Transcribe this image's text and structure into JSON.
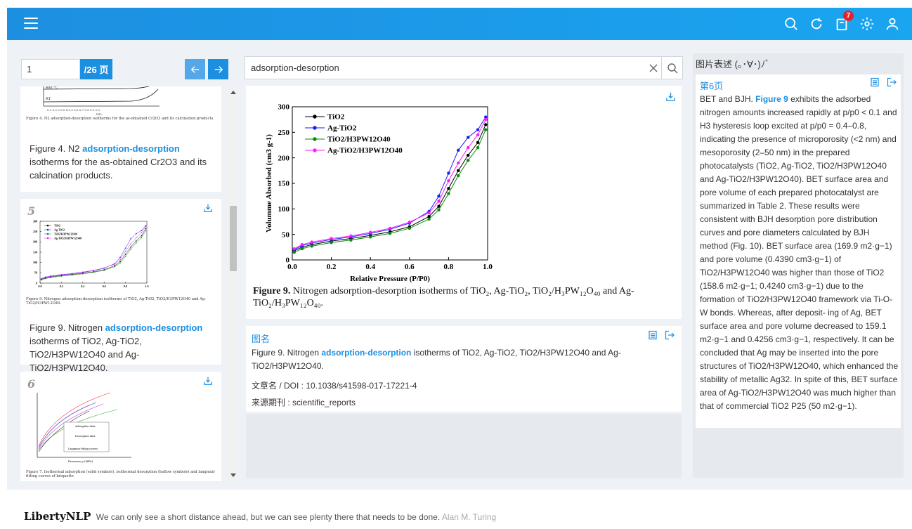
{
  "header": {
    "menu_icon": "hamburger-menu-icon",
    "icons": [
      "search-icon",
      "refresh-icon",
      "document-icon",
      "gear-icon",
      "user-icon"
    ],
    "badge_count": "7",
    "accent_color": "#1d8fe1"
  },
  "pager": {
    "page_value": "1",
    "total_label": "/26 页"
  },
  "cards": [
    {
      "caption_small": "Figure 4.  N2 adsorption-desorption isotherms for the as-obtained Cr2O3 and its calcination products.",
      "text_before": "Figure 4. N2 ",
      "highlight": "adsorption-desorption",
      "text_after": " isotherms for the as-obtained Cr2O3 and its calcination products."
    },
    {
      "num": "5",
      "caption_small": "Figure 9.  Nitrogen adsorption-desorption isotherms of TiO2, Ag-TiO2, TiO2/H3PW12O40 and Ag-TiO2/H3PW12O40.",
      "text_before": "Figure 9. Nitrogen ",
      "highlight": "adsorption-desorption",
      "text_after": " isotherms of TiO2, Ag-TiO2, TiO2/H3PW12O40 and Ag-TiO2/H3PW12O40."
    },
    {
      "num": "6",
      "caption_small": "Figure 7.  Isothermal adsorption (solid symbols), isothermal desorption (hollow symbols) and langmuir fitting curves of briquette"
    }
  ],
  "search": {
    "value": "adsorption-desorption"
  },
  "figure": {
    "caption_bold": "Figure 9.",
    "caption_text": "  Nitrogen adsorption-desorption isotherms of TiO₂, Ag-TiO₂, TiO₂/H₃PW₁₂O₄₀ and Ag-TiO₂/H₃PW₁₂O₄₀."
  },
  "chart_data": {
    "type": "line",
    "xlabel": "Relative Pressure (P/P0)",
    "ylabel": "Volumme Absorbed (cm3 g-1)",
    "xlim": [
      0,
      1.0
    ],
    "ylim": [
      0,
      300
    ],
    "xticks": [
      "0.0",
      "0.2",
      "0.4",
      "0.6",
      "0.8",
      "1.0"
    ],
    "yticks": [
      "0",
      "50",
      "100",
      "150",
      "200",
      "250",
      "300"
    ],
    "legend_position": "top-left",
    "series": [
      {
        "name": "TiO2",
        "color": "#000000",
        "x": [
          0.01,
          0.05,
          0.1,
          0.2,
          0.3,
          0.4,
          0.5,
          0.6,
          0.7,
          0.75,
          0.8,
          0.85,
          0.9,
          0.95,
          0.99
        ],
        "y": [
          18,
          25,
          30,
          37,
          42,
          48,
          55,
          65,
          85,
          105,
          140,
          175,
          205,
          230,
          265
        ]
      },
      {
        "name": "Ag-TiO2",
        "color": "#1a1aff",
        "x": [
          0.01,
          0.05,
          0.1,
          0.2,
          0.3,
          0.4,
          0.5,
          0.6,
          0.7,
          0.75,
          0.8,
          0.85,
          0.9,
          0.95,
          0.99
        ],
        "y": [
          20,
          28,
          33,
          40,
          45,
          52,
          60,
          72,
          95,
          125,
          170,
          215,
          240,
          255,
          280
        ]
      },
      {
        "name": "TiO2/H3PW12O40",
        "color": "#0a8a0a",
        "x": [
          0.01,
          0.05,
          0.1,
          0.2,
          0.3,
          0.4,
          0.5,
          0.6,
          0.7,
          0.75,
          0.8,
          0.85,
          0.9,
          0.95,
          0.99
        ],
        "y": [
          15,
          22,
          27,
          34,
          39,
          45,
          52,
          62,
          80,
          98,
          130,
          165,
          195,
          220,
          255
        ]
      },
      {
        "name": "Ag-TiO2/H3PW12O40",
        "color": "#ff1aff",
        "x": [
          0.01,
          0.05,
          0.1,
          0.2,
          0.3,
          0.4,
          0.5,
          0.6,
          0.7,
          0.75,
          0.8,
          0.85,
          0.9,
          0.95,
          0.99
        ],
        "y": [
          22,
          30,
          35,
          42,
          47,
          54,
          62,
          74,
          92,
          115,
          155,
          190,
          220,
          245,
          275
        ]
      }
    ]
  },
  "info": {
    "title": "图名",
    "text_before": "Figure 9. Nitrogen ",
    "highlight": "adsorption-desorption",
    "text_after": " isotherms of TiO2, Ag-TiO2, TiO2/H3PW12O40 and Ag-TiO2/H3PW12O40.",
    "doi": "文章名 / DOI : 10.1038/s41598-017-17221-4",
    "source": "来源期刊 : scientific_reports"
  },
  "right": {
    "header": "图片表述 (｡･∀･)ﾉﾞ",
    "page_title": "第6页",
    "text_before": "BET and BJH. ",
    "highlight": "Figure 9",
    "text_after": " exhibits the adsorbed nitrogen amounts increased rapidly at p/p0 < 0.1 and H3 hysteresis loop excited at p/p0 = 0.4–0.8, indicating the presence of microporosity (<2 nm) and mesoporosity (2–50 nm) in the prepared photocatalysts (TiO2, Ag-TiO2, TiO2/H3PW12O40 and Ag-TiO2/H3PW12O40). BET surface area and pore volume of each prepared photocatalyst are summarized in Table 2. These results were consistent with BJH desorption pore distribution curves and pore diameters calculated by BJH method (Fig. 10). BET surface area (169.9 m2·g−1) and pore volume (0.4390 cm3·g−1) of TiO2/H3PW12O40 was higher than those of TiO2 (158.6 m2·g−1; 0.4240 cm3·g−1) due to the formation of TiO2/H3PW12O40 framework via Ti-O-W bonds. Whereas, after deposit- ing of Ag, BET surface area and pore volume decreased to 159.1 m2·g−1 and 0.4256 cm3·g−1, respectively. It can be concluded that Ag may be inserted into the pore structures of TiO2/H3PW12O40, which enhanced the stability of metallic Ag32. In spite of this, BET surface area of Ag-TiO2/H3PW12O40 was much higher than that of commercial TiO2 P25 (50 m2·g−1)."
  },
  "footer": {
    "brand": "LibertyNLP",
    "quote": "We can only see a short distance ahead, but we can see plenty there that needs to be done.",
    "author": "Alan M. Turing"
  }
}
